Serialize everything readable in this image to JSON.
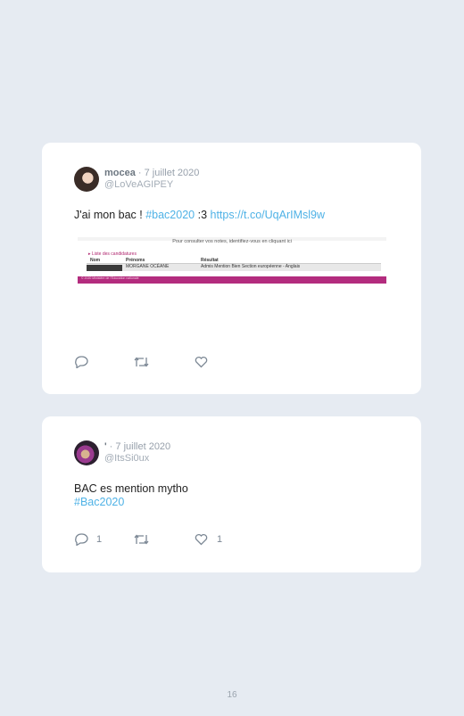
{
  "tweets": [
    {
      "name": "mocea",
      "date": " · 7 juillet 2020",
      "handle": "@LoVeAGIPEY",
      "text_plain": "J'ai mon bac ! ",
      "hashtag": "#bac2020",
      "text_mid": " :3 ",
      "link": "https://t.co/UqArIMsl9w",
      "media": {
        "notice": "Pour consulter vos notes, identifiez-vous en cliquant ici",
        "list_label": "Liste des candidatures",
        "headers": [
          "Nom",
          "Prénoms",
          "Résultat"
        ],
        "row": [
          "",
          "MORGANE OCÉANE",
          "Admis Mention Bien Section européenne - Anglais"
        ],
        "footer": "© 2020 Ministère de l'Éducation nationale"
      },
      "replies": "",
      "retweets": "",
      "likes": ""
    },
    {
      "name": "'",
      "date": " · 7 juillet 2020",
      "handle": "@ItsSi0ux",
      "text_plain": "BAC es mention mytho",
      "hashtag": "#Bac2020",
      "replies": "1",
      "retweets": "",
      "likes": "1"
    }
  ],
  "page_number": "16",
  "colors": {
    "background": "#e6ebf2",
    "link": "#4fb2e6",
    "card": "#ffffff"
  }
}
